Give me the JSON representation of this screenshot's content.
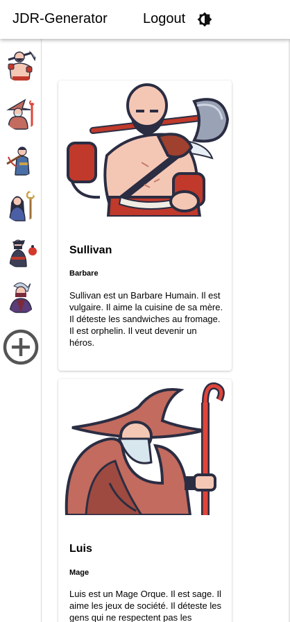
{
  "header": {
    "title": "JDR-Generator",
    "logout_label": "Logout",
    "theme_icon": "brightness-icon"
  },
  "sidebar": {
    "avatars": [
      {
        "icon": "barbarian-avatar-icon"
      },
      {
        "icon": "wizard-avatar-icon"
      },
      {
        "icon": "crossbow-hunter-avatar-icon"
      },
      {
        "icon": "priestess-avatar-icon"
      },
      {
        "icon": "rogue-avatar-icon"
      },
      {
        "icon": "ninja-avatar-icon"
      }
    ],
    "add_icon": "add-circle-icon"
  },
  "characters": [
    {
      "name": "Sullivan",
      "class": "Barbare",
      "description": "Sullivan est un Barbare Humain. Il est vulgaire. Il aime la cuisine de sa mère. Il déteste les sandwiches au fromage. Il est orphelin. Il veut devenir un héros.",
      "portrait_icon": "barbarian-portrait"
    },
    {
      "name": "Luis",
      "class": "Mage",
      "description": "Luis est un Mage Orque. Il est sage. Il aime les jeux de société. Il déteste les gens qui ne respectent pas les",
      "portrait_icon": "wizard-portrait"
    }
  ],
  "colors": {
    "accent": "#c0392b",
    "skin": "#f4c7b5",
    "outline": "#2b2d42",
    "sidebar_border": "#d9d9d9"
  }
}
